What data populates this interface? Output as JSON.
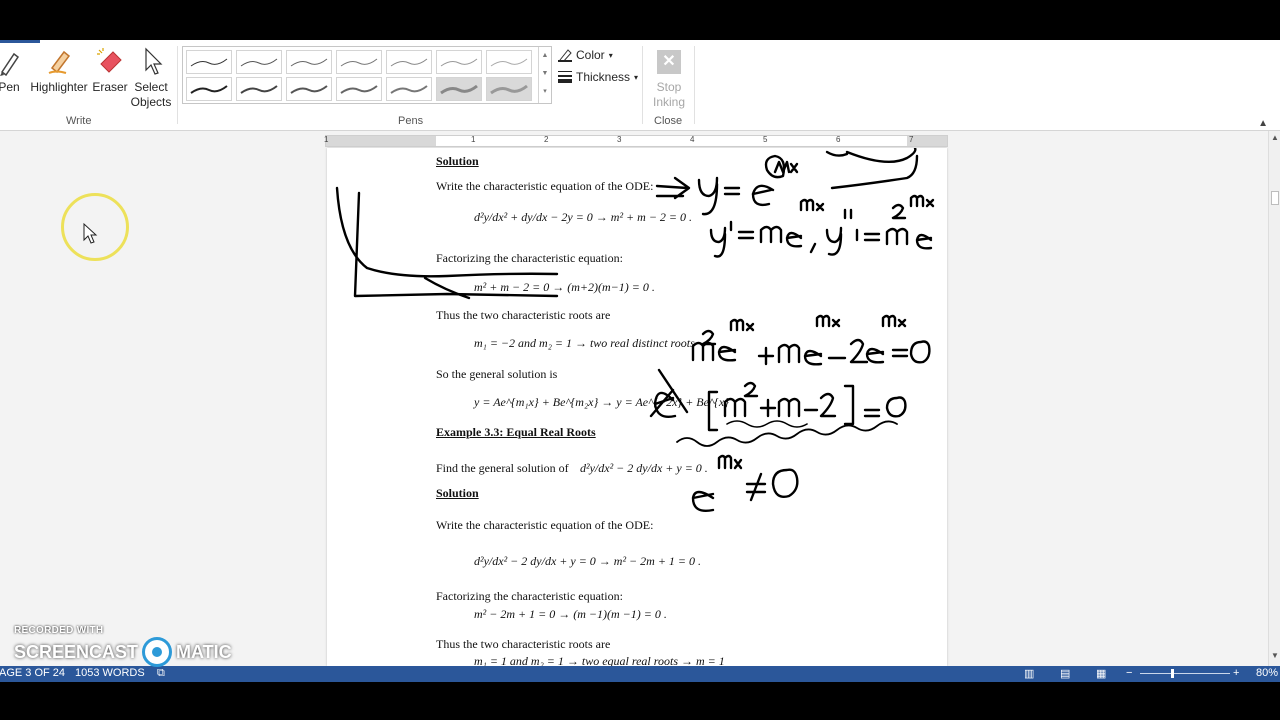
{
  "ribbon": {
    "write_group": {
      "label": "Write",
      "pen": "Pen",
      "highlighter": "Highlighter",
      "eraser": "Eraser",
      "select_objects_1": "Select",
      "select_objects_2": "Objects"
    },
    "pens_group": {
      "label": "Pens"
    },
    "color": "Color",
    "thickness": "Thickness",
    "close_group": {
      "label": "Close",
      "stop_inking_1": "Stop",
      "stop_inking_2": "Inking"
    }
  },
  "ruler": {
    "ticks": [
      "1",
      "1",
      "2",
      "3",
      "4",
      "5",
      "6",
      "7"
    ]
  },
  "document": {
    "solution_heading": "Solution",
    "line_char_eq": "Write the characteristic equation of the ODE:",
    "eq1": "d²y/dx² + dy/dx − 2y = 0 → m² + m − 2 = 0 .",
    "factorizing": "Factorizing the characteristic equation:",
    "eq2": "m² + m − 2 = 0 → (m+2)(m−1) = 0 .",
    "two_roots": "Thus the two characteristic roots are",
    "eq3": "m₁ = −2 and m₂ = 1 →  two real distinct roots",
    "general": "So the general solution is",
    "eq4": "y = Ae^{m₁x} + Be^{m₂x} → y = Ae^{−2x} + Be^{x}",
    "example_heading": "Example 3.3:  Equal Real Roots",
    "find_general": "Find the general solution of",
    "eq5": "d²y/dx² − 2 dy/dx + y = 0 .",
    "solution_heading2": "Solution",
    "line_char_eq2": "Write the characteristic equation of the ODE:",
    "eq6": "d²y/dx² − 2 dy/dx + y = 0 → m² − 2m + 1 = 0 .",
    "factorizing2": "Factorizing the characteristic equation:",
    "eq7": "m² − 2m + 1 = 0 → (m −1)(m −1) = 0 .",
    "two_roots2": "Thus the two characteristic roots are",
    "eq8": "m₁ = 1 and m₂ = 1 →  two equal real roots → m = 1"
  },
  "status_bar": {
    "page": "AGE 3 OF 24",
    "words": "1053 WORDS",
    "zoom": "80%"
  },
  "watermark": {
    "recorded": "RECORDED WITH",
    "brand_left": "SCREENCAST",
    "brand_right": "MATIC"
  },
  "colors": {
    "status_bar": "#2b579a",
    "ink": "#000000",
    "cursor_ring": "#ede15a"
  }
}
